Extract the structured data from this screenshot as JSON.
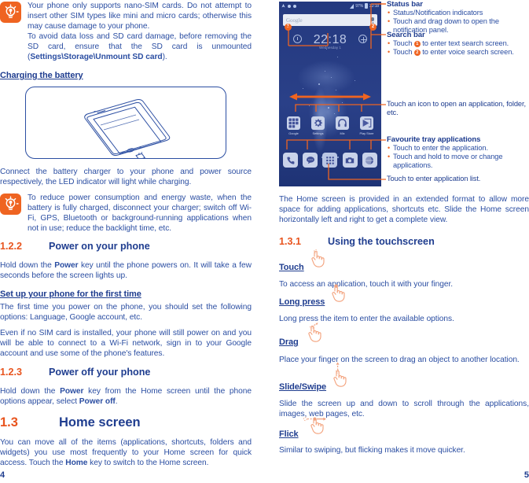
{
  "document": {
    "left_page_number": "4",
    "right_page_number": "5"
  },
  "colors": {
    "body_blue": "#2b4ea2",
    "heading_blue": "#1f3d8f",
    "accent_orange": "#ef6421",
    "number_orange": "#e8541e",
    "phone_screen_bg": "#223a7e"
  },
  "left_column": {
    "tip1": {
      "icon": "lightbulb-tip-icon",
      "lines": [
        "Your phone only supports nano-SIM cards. Do not attempt to insert other SIM types like mini and micro cards; otherwise this may cause damage to your phone.",
        "To avoid data loss and SD card damage, before removing the SD card, ensure that the SD card is unmounted (",
        "Settings\\Storage\\Unmount SD card",
        ")."
      ],
      "para1": "Your phone only supports nano-SIM cards. Do not attempt to insert other SIM types like mini and micro cards; otherwise this may cause damage to your phone.",
      "para2_prefix": "To avoid data loss and SD card damage, before removing the SD card, ensure that the SD card is unmounted (",
      "para2_bold": "Settings\\Storage\\Unmount SD card",
      "para2_suffix": ")."
    },
    "charging_heading": "Charging the battery",
    "illustration_alt": "Phone being charged with USB cable",
    "charging_text": "Connect the battery charger to your phone and power source respectively, the LED indicator will light while charging.",
    "tip2": {
      "icon": "lightbulb-tip-icon",
      "text": "To reduce power consumption and energy waste, when the battery is fully charged, disconnect your charger; switch off Wi-Fi, GPS, Bluetooth or background-running applications when not in use; reduce the backlight time, etc."
    },
    "section_122": {
      "number": "1.2.2",
      "title": "Power on your phone",
      "para1_a": "Hold down the ",
      "para1_bold": "Power",
      "para1_b": " key until the phone powers on. It will take a few seconds before the screen lights up.",
      "sub_heading": "Set up your phone for the first time",
      "para2": "The first time you power on the phone, you should set the following options: Language, Google account, etc.",
      "para3": "Even if no SIM card is installed, your phone will still power on and you will be able to connect to a Wi-Fi network, sign in to your Google account and use some of the phone's features."
    },
    "section_123": {
      "number": "1.2.3",
      "title": "Power off your phone",
      "para_a": "Hold down the ",
      "para_bold1": "Power",
      "para_b": " key from the Home screen until the phone options appear, select ",
      "para_bold2": "Power off",
      "para_c": "."
    },
    "section_13": {
      "number": "1.3",
      "title": "Home screen",
      "para_a": "You can move all of the items (applications, shortcuts, folders and widgets) you use most frequently to your Home screen for quick access. Touch the ",
      "para_bold": "Home",
      "para_b": " key to switch to the Home screen."
    }
  },
  "phone_mock": {
    "status_bar": {
      "battery_percent": "97%",
      "time": "22:18",
      "icons": [
        "wifi-icon",
        "dot-icon",
        "dot-icon",
        "signal-icon",
        "battery-icon"
      ]
    },
    "search_bar": {
      "placeholder": "Google",
      "mic_icon": "microphone-icon",
      "badge_text": "1",
      "badge_mic": "2"
    },
    "clock_widget": {
      "time": "22:18",
      "subtitle": "Wednesday 1",
      "left_icon": "alarm-icon",
      "right_icon": "add-icon"
    },
    "apps": [
      {
        "label": "Google",
        "icon": "google-folder-icon"
      },
      {
        "label": "Settings",
        "icon": "gear-icon"
      },
      {
        "label": "Mix",
        "icon": "headphones-icon"
      },
      {
        "label": "Play Store",
        "icon": "play-store-icon"
      }
    ],
    "page_dots": {
      "count": 3,
      "active_index": 1
    },
    "dock": [
      {
        "icon": "phone-icon",
        "name": "dock-phone"
      },
      {
        "icon": "message-icon",
        "name": "dock-messages"
      },
      {
        "icon": "app-grid-icon",
        "name": "dock-app-drawer"
      },
      {
        "icon": "camera-icon",
        "name": "dock-camera"
      },
      {
        "icon": "browser-icon",
        "name": "dock-browser"
      }
    ],
    "swipe_arrow": "double-arrow-left-right"
  },
  "annotations": {
    "status_bar": {
      "title": "Status bar",
      "bullets": [
        "Status/Notification indicators",
        "Touch and drag down to open the notification panel."
      ]
    },
    "search_bar": {
      "title": "Search bar",
      "bullet1_pre": "Touch ",
      "bullet1_badge": "1",
      "bullet1_post": " to enter text search screen.",
      "bullet2_pre": "Touch ",
      "bullet2_badge": "2",
      "bullet2_post": " to enter voice search screen."
    },
    "icons_note": "Touch an icon to open an application, folder, etc.",
    "favourite_tray": {
      "title": "Favourite tray applications",
      "bullets": [
        "Touch to enter the application.",
        "Touch and hold to move or change applications."
      ]
    },
    "app_list_note": "Touch to enter application list."
  },
  "right_column": {
    "home_screen_para": "The Home screen is provided in an extended format to allow more space for adding applications, shortcuts etc. Slide the Home screen horizontally left and right to get a complete view.",
    "section_131": {
      "number": "1.3.1",
      "title": "Using the touchscreen"
    },
    "gestures": [
      {
        "name": "Touch",
        "icon": "hand-touch-icon",
        "text": "To access an application, touch it with your finger."
      },
      {
        "name": "Long press",
        "icon": "hand-long-press-icon",
        "text": "Long press the item to enter the available options."
      },
      {
        "name": "Drag",
        "icon": "hand-drag-icon",
        "text": "Place your finger on the screen to drag an object to another location."
      },
      {
        "name": "Slide/Swipe",
        "icon": "hand-slide-icon",
        "text": "Slide the screen up and down to scroll through the applications, images, web pages, etc."
      },
      {
        "name": "Flick",
        "icon": "hand-flick-icon",
        "text": "Similar to swiping, but flicking makes it move quicker."
      }
    ]
  }
}
